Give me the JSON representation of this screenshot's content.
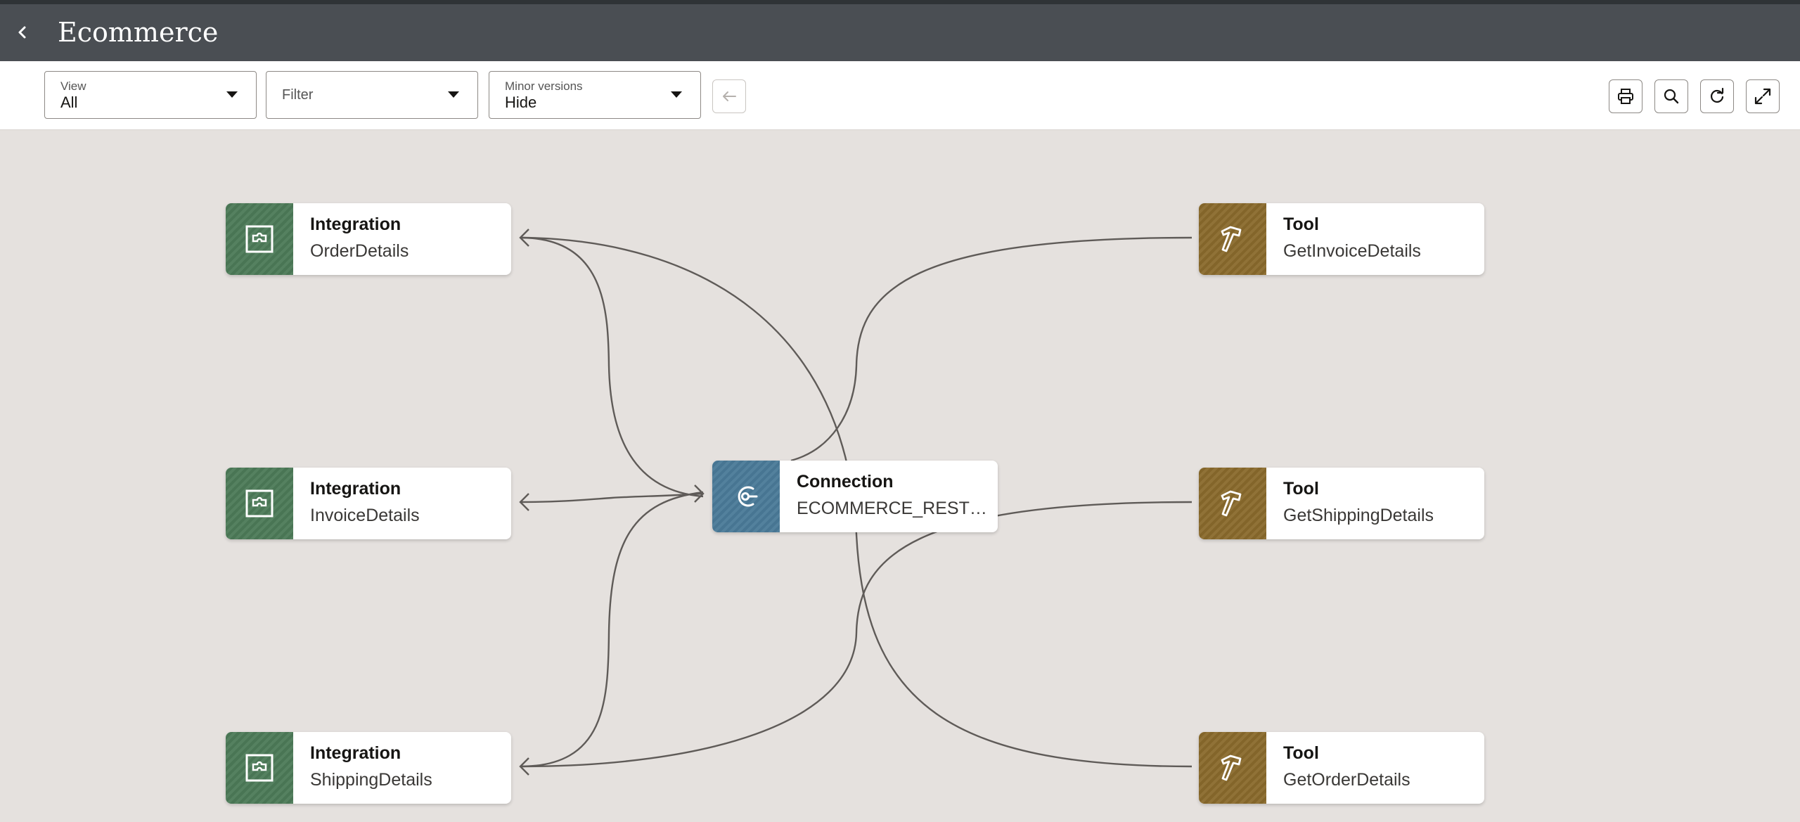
{
  "header": {
    "title": "Ecommerce"
  },
  "toolbar": {
    "view": {
      "label": "View",
      "value": "All"
    },
    "filter": {
      "placeholder": "Filter"
    },
    "minor_versions": {
      "label": "Minor versions",
      "value": "Hide"
    }
  },
  "nodes": {
    "integration_order": {
      "type": "Integration",
      "name": "OrderDetails"
    },
    "integration_invoice": {
      "type": "Integration",
      "name": "InvoiceDetails"
    },
    "integration_shipping": {
      "type": "Integration",
      "name": "ShippingDetails"
    },
    "connection": {
      "type": "Connection",
      "name": "ECOMMERCE_REST_T…"
    },
    "tool_invoice": {
      "type": "Tool",
      "name": "GetInvoiceDetails"
    },
    "tool_shipping": {
      "type": "Tool",
      "name": "GetShippingDetails"
    },
    "tool_order": {
      "type": "Tool",
      "name": "GetOrderDetails"
    }
  },
  "colors": {
    "header": "#4a4e53",
    "canvas": "#e5e1de",
    "integration": "#4c7a57",
    "tool": "#8a6a2c",
    "connection": "#4a7a98",
    "edge": "#5f5b58"
  },
  "icons": {
    "back": "chevron-left-icon",
    "integration": "puzzle-icon",
    "tool": "hammer-icon",
    "connection": "connector-icon",
    "print": "printer-icon",
    "search": "search-icon",
    "refresh": "refresh-icon",
    "expand": "expand-icon",
    "disabled_back": "arrow-left-icon"
  }
}
